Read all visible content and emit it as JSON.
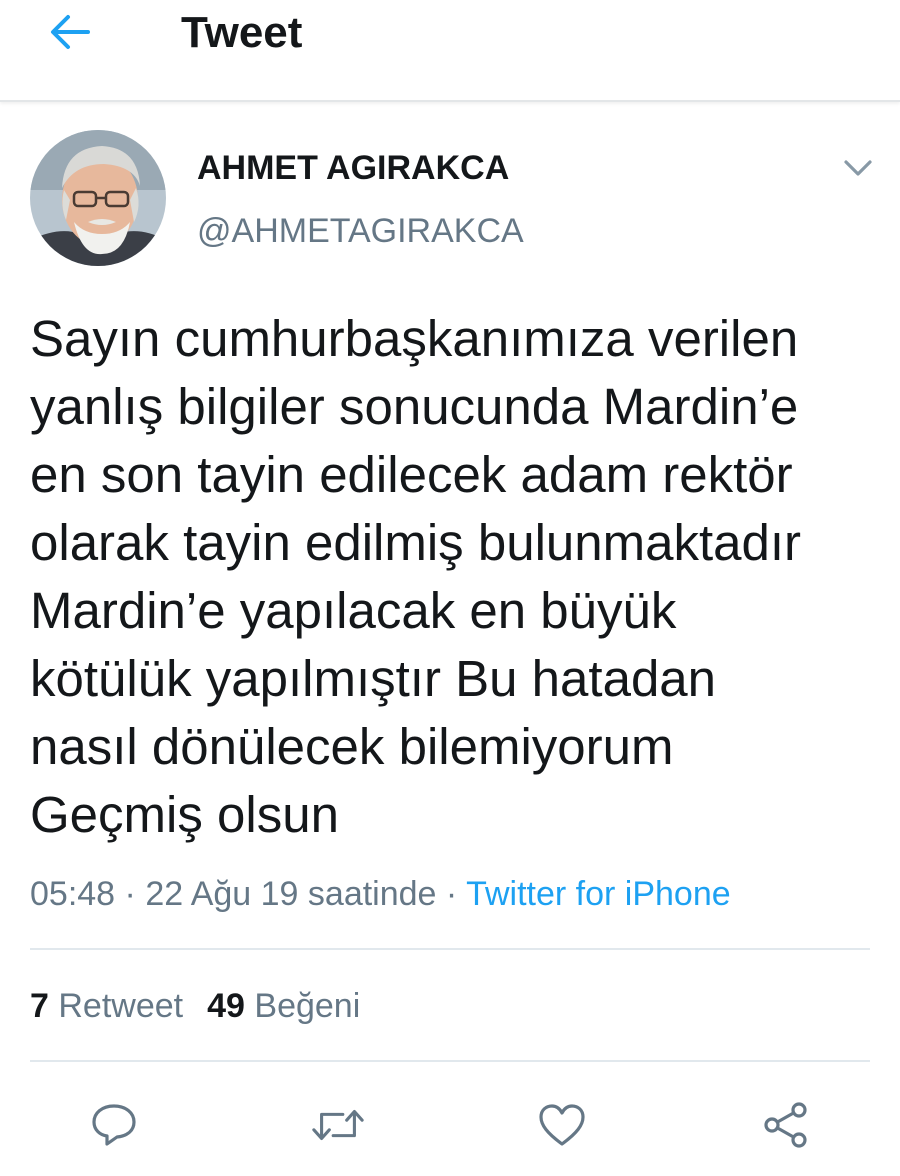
{
  "header": {
    "title": "Tweet",
    "back_icon": "back-arrow-icon"
  },
  "author": {
    "display_name": "AHMET AGIRAKCA",
    "handle": "@AHMETAGIRAKCA"
  },
  "tweet": {
    "lines": [
      "Sayın cumhurbaşkanımıza verilen",
      "yanlış bilgiler sonucunda Mardin’e",
      "en son tayin edilecek adam rektör",
      "olarak tayin edilmiş bulunmaktadır",
      "Mardin’e yapılacak en büyük",
      "kötülük yapılmıştır Bu hatadan",
      "nasıl dönülecek bilemiyorum",
      "Geçmiş olsun"
    ]
  },
  "meta": {
    "time": "05:48",
    "sep1": " · ",
    "date": "22 Ağu 19 saatinde",
    "sep2": " · ",
    "source": "Twitter for iPhone"
  },
  "stats": {
    "retweet_count": "7",
    "retweet_label": "Retweet",
    "like_count": "49",
    "like_label": "Beğeni"
  },
  "actions": [
    "reply-icon",
    "retweet-icon",
    "like-icon",
    "share-icon"
  ],
  "colors": {
    "accent": "#1da1f2",
    "text_primary": "#14171a",
    "text_secondary": "#657786",
    "divider": "#e1e8ed"
  }
}
